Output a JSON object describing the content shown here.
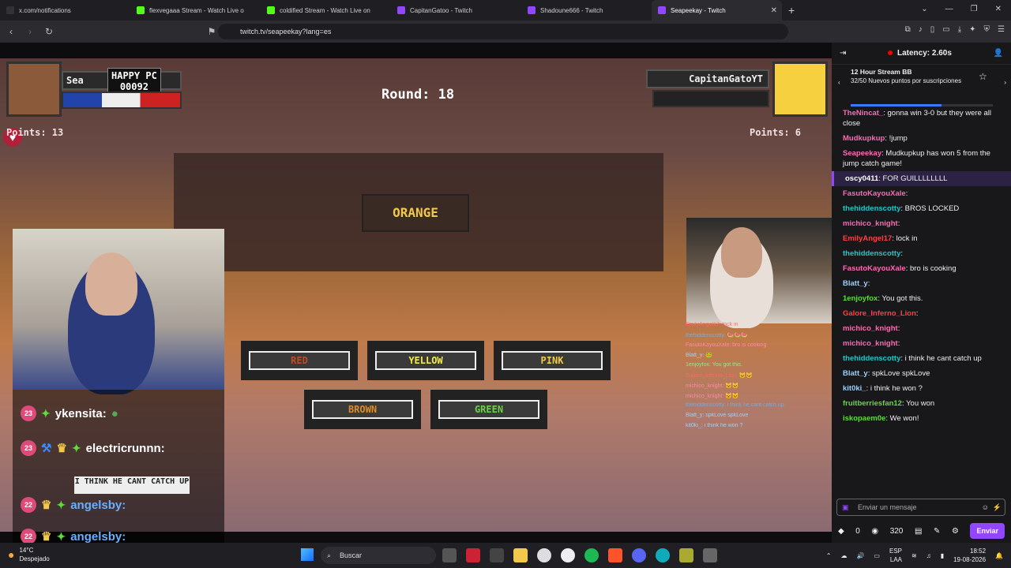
{
  "tabs": [
    {
      "label": "x.com/notifications",
      "color": "#444"
    },
    {
      "label": "flexvegaaa Stream - Watch Live o",
      "color": "#5fdc3a"
    },
    {
      "label": "coldified Stream - Watch Live on",
      "color": "#5fdc3a"
    },
    {
      "label": "CapitanGatoo - Twitch",
      "color": "#9147ff"
    },
    {
      "label": "Shadoune666 - Twitch",
      "color": "#9147ff"
    },
    {
      "label": "Seapeekay - Twitch",
      "color": "#9147ff"
    }
  ],
  "url": "twitch.tv/seapeekay?lang=es",
  "game": {
    "left_player": "Sea",
    "happy_label": "HAPPY PC",
    "happy_score": "00092",
    "right_player": "CapitanGatoYT",
    "round": "Round: 18",
    "points_left": "Points: 13",
    "points_right": "Points: 6",
    "prompt_word": "ORANGE",
    "buttons": [
      "RED",
      "YELLOW",
      "PINK",
      "BROWN",
      "GREEN"
    ],
    "speech": "I THINK HE CANT CATCH UP"
  },
  "overlay_chat": [
    {
      "badge": "23",
      "user": "ykensita:"
    },
    {
      "badge": "23",
      "user": "electricrunnn:"
    },
    {
      "badge": "22",
      "user": "angelsby:"
    },
    {
      "badge": "22",
      "user": "angelsby:"
    }
  ],
  "mini_chat": [
    "EmilyAngel17: lock in",
    "thehiddenscotty: 🍉🍉🍉",
    "FasutoKayouXale: bro is cooking",
    "Blatt_y: 🐸",
    "1enjoyfox: You got this.",
    "Galore_Inferno_Lion: 🐱🐱",
    "michico_knight: 🐱🐱",
    "michico_knight: 🐱🐱",
    "thehiddenscotty: i think he cant catch up",
    "Blatt_y: spkLove spkLove",
    "kit0ki_: i think he won ?"
  ],
  "chat": {
    "latency": "Latency: 2.60s",
    "goal_title": "12 Hour Stream BB",
    "goal_sub": "32/50 Nuevos puntos por suscripciones",
    "goal_progress": 0.64,
    "messages": [
      {
        "user": "TheNincat_",
        "color": "#ff69b4",
        "text": ": gonna win 3-0 but they were all close"
      },
      {
        "user": "Mudkupkup",
        "color": "#ff69b4",
        "text": ": !jump"
      },
      {
        "user": "Seapeekay",
        "color": "#ff69b4",
        "text": ": Mudkupkup has won 5 from the jump catch game!"
      },
      {
        "user": "oscy0411",
        "color": "#ffffff",
        "text": ": FOR GUILLLLLLLL",
        "hl": true
      },
      {
        "user": "FasutoKayouXale",
        "color": "#ff69b4",
        "text": ":"
      },
      {
        "user": "thehiddenscotty",
        "color": "#1ec8c8",
        "text": ": BROS LOCKED"
      },
      {
        "user": "michico_knight",
        "color": "#ff69b4",
        "text": ":"
      },
      {
        "user": "EmilyAngel17",
        "color": "#ff4040",
        "text": ": lock in"
      },
      {
        "user": "thehiddenscotty",
        "color": "#1ec8c8",
        "text": ":"
      },
      {
        "user": "FasutoKayouXale",
        "color": "#ff69b4",
        "text": ": bro is cooking"
      },
      {
        "user": "Blatt_y",
        "color": "#9ad0ff",
        "text": ":"
      },
      {
        "user": "1enjoyfox",
        "color": "#5fdc3a",
        "text": ": You got this."
      },
      {
        "user": "Galore_Inferno_Lion",
        "color": "#ff4040",
        "text": ":"
      },
      {
        "user": "michico_knight",
        "color": "#ff69b4",
        "text": ":"
      },
      {
        "user": "michico_knight",
        "color": "#ff69b4",
        "text": ":"
      },
      {
        "user": "thehiddenscotty",
        "color": "#1ec8c8",
        "text": ": i think he cant catch up"
      },
      {
        "user": "Blatt_y",
        "color": "#9ad0ff",
        "text": ": spkLove spkLove"
      },
      {
        "user": "kit0ki_",
        "color": "#9ad0ff",
        "text": ": i think he won ?"
      },
      {
        "user": "fruitberriesfan12",
        "color": "#5fdc3a",
        "text": ": You won"
      },
      {
        "user": "iskopaem0e",
        "color": "#5fdc3a",
        "text": ": We won!"
      }
    ],
    "input_placeholder": "Enviar un mensaje",
    "points_zero": "0",
    "points_value": "320",
    "send_label": "Enviar"
  },
  "taskbar": {
    "temp": "14°C",
    "weather": "Despejado",
    "search": "Buscar",
    "lang": "ESP",
    "lang2": "LAA",
    "time": "18:52",
    "date": "19-08-2026"
  }
}
